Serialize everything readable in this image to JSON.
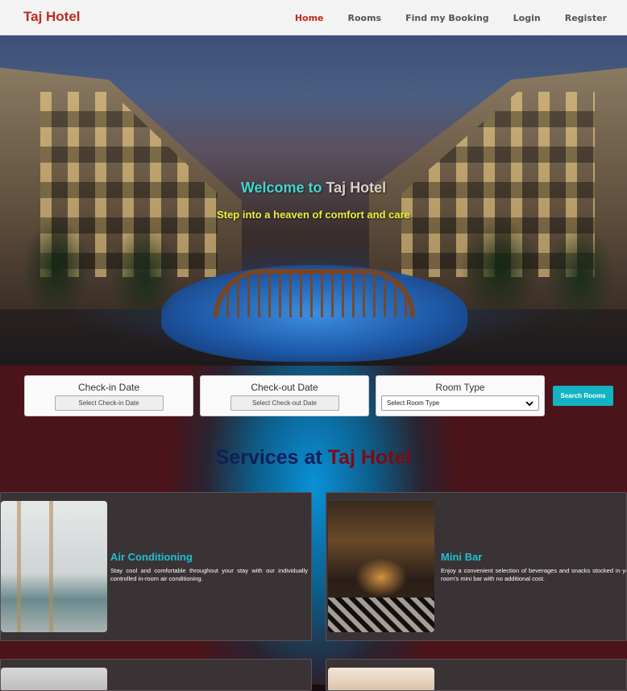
{
  "brand": "Taj Hotel",
  "nav": [
    {
      "label": "Home",
      "active": true
    },
    {
      "label": "Rooms",
      "active": false
    },
    {
      "label": "Find my Booking",
      "active": false
    },
    {
      "label": "Login",
      "active": false
    },
    {
      "label": "Register",
      "active": false
    }
  ],
  "hero": {
    "title_prefix": "Welcome to",
    "title_name": "Taj Hotel",
    "subtitle": "Step into a heaven of comfort and care"
  },
  "search": {
    "checkin_label": "Check-in Date",
    "checkin_button": "Select Check-in Date",
    "checkout_label": "Check-out Date",
    "checkout_button": "Select Check-out Date",
    "roomtype_label": "Room Type",
    "roomtype_selected": "Select Room Type",
    "search_button": "Search Rooms"
  },
  "services": {
    "title_prefix": "Services at",
    "title_name": "Taj Hotel",
    "items": [
      {
        "title": "Air Conditioning",
        "text": "Stay cool and comfortable throughout your stay with our individually controlled in-room air conditioning."
      },
      {
        "title": "Mini Bar",
        "text": "Enjoy a convenient selection of beverages and snacks stocked in your room's mini bar with no additional cost."
      }
    ]
  },
  "colors": {
    "brand": "#c0281c",
    "accent": "#13b3c3",
    "service_title": "#1ec0cf"
  }
}
